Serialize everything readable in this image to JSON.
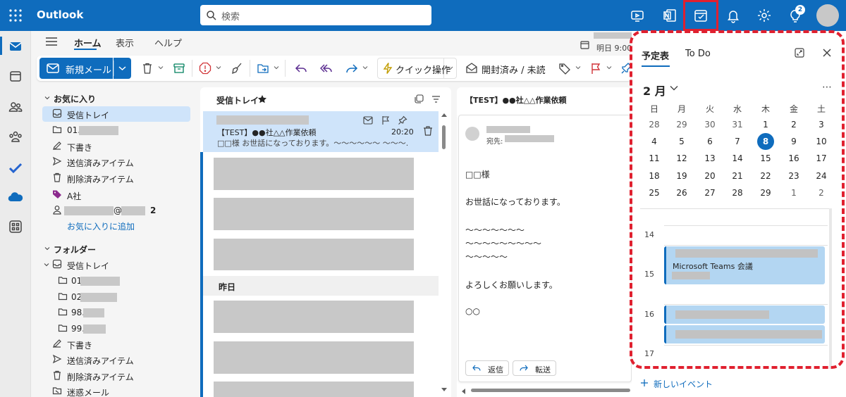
{
  "topbar": {
    "app_name": "Outlook",
    "search_placeholder": "検索",
    "notification_count": "2"
  },
  "ribbon": {
    "tabs": [
      "ホーム",
      "表示",
      "ヘルプ"
    ],
    "date_label": "明日 9:00",
    "new_mail": "新規メール",
    "quick_steps": "クイック操作",
    "read_unread": "開封済み / 未読"
  },
  "folders": {
    "favorites_header": "お気に入り",
    "favorites": [
      {
        "label": "受信トレイ",
        "icon": "inbox-icon"
      },
      {
        "label": "01.",
        "icon": "folder-icon"
      },
      {
        "label": "下書き",
        "icon": "pencil-icon"
      },
      {
        "label": "送信済みアイテム",
        "icon": "send-icon"
      },
      {
        "label": "削除済みアイテム",
        "icon": "trash-icon"
      },
      {
        "label": "A社",
        "icon": "tag-icon"
      },
      {
        "label": "@",
        "icon": "person-icon",
        "count": "2"
      }
    ],
    "add_favorite": "お気に入りに追加",
    "folders_header": "フォルダー",
    "inbox": "受信トレイ",
    "subfolders": [
      "01",
      "02",
      "98.",
      "99."
    ],
    "others": [
      {
        "label": "下書き",
        "icon": "pencil-icon"
      },
      {
        "label": "送信済みアイテム",
        "icon": "send-icon"
      },
      {
        "label": "削除済みアイテム",
        "icon": "trash-icon"
      },
      {
        "label": "迷惑メール",
        "icon": "junk-icon"
      }
    ]
  },
  "message_list": {
    "title": "受信トレイ",
    "selected": {
      "subject": "【TEST】●●社△△作業依頼",
      "time": "20:20",
      "preview": "□□様 お世話になっております。～～～～～～ ～～～..."
    },
    "yesterday_label": "昨日"
  },
  "reading": {
    "subject": "【TEST】●●社△△作業依頼",
    "to_label": "宛先:",
    "body": [
      "□□様",
      "お世話になっております。",
      "～～～～～～～",
      "～～～～～～～～～",
      "～～～～～",
      "よろしくお願いします。",
      "○○"
    ],
    "reply": "返信",
    "forward": "転送"
  },
  "calendar": {
    "tab_calendar": "予定表",
    "tab_todo": "To Do",
    "month": "2 月",
    "weekdays": [
      "日",
      "月",
      "火",
      "水",
      "木",
      "金",
      "土"
    ],
    "weeks": [
      [
        "28",
        "29",
        "30",
        "31",
        "1",
        "2",
        "3"
      ],
      [
        "4",
        "5",
        "6",
        "7",
        "8",
        "9",
        "10"
      ],
      [
        "11",
        "12",
        "13",
        "14",
        "15",
        "16",
        "17"
      ],
      [
        "18",
        "19",
        "20",
        "21",
        "22",
        "23",
        "24"
      ],
      [
        "25",
        "26",
        "27",
        "28",
        "29",
        "1",
        "2"
      ]
    ],
    "today": "8",
    "hours": [
      "14",
      "15",
      "16",
      "17"
    ],
    "event_title": "Microsoft Teams 会議",
    "new_event": "新しいイベント"
  },
  "colors": {
    "brand": "#0f6cbd",
    "highlight": "#e0202f",
    "selection": "#cfe4fa",
    "event": "#b3d6f2"
  }
}
